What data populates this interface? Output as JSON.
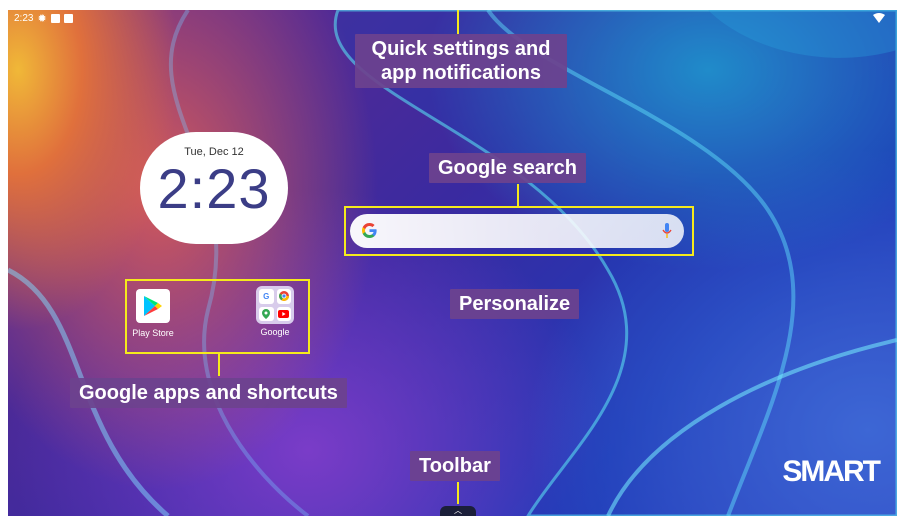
{
  "status_bar": {
    "time": "2:23"
  },
  "clock_widget": {
    "date": "Tue, Dec 12",
    "time": "2:23"
  },
  "apps": [
    {
      "label": "Play Store"
    },
    {
      "label": "Google"
    }
  ],
  "folder_icons": [
    "G",
    "chrome",
    "maps",
    "youtube"
  ],
  "annotations": {
    "quick_settings": "Quick settings and app notifications",
    "google_search": "Google search",
    "personalize": "Personalize",
    "google_apps": "Google apps and shortcuts",
    "toolbar": "Toolbar"
  },
  "brand": {
    "logo_text": "SMART"
  },
  "colors": {
    "annotation_yellow": "#f5ea1c",
    "label_bg": "#6c428e",
    "clock_text": "#3b3d86"
  }
}
